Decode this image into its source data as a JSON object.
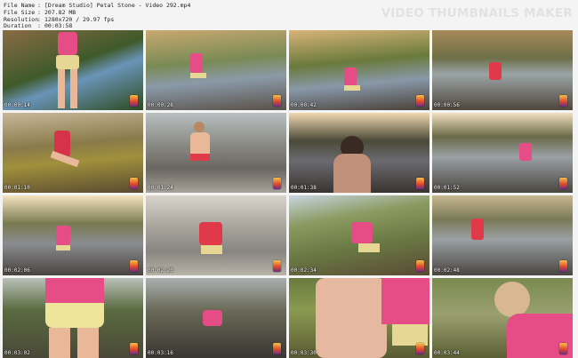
{
  "header": {
    "rows": [
      {
        "key": "File Name",
        "sep": ":",
        "value": "[Dream Studio] Petal Stone - Video 292.mp4"
      },
      {
        "key": "File Size",
        "sep": ":",
        "value": "207.82 MB"
      },
      {
        "key": "Resolution",
        "sep": ":",
        "value": "1280x720 / 29.97 fps"
      },
      {
        "key": "Duration",
        "sep": ":",
        "value": "00:03:58"
      }
    ],
    "watermark": "VIDEO THUMBNAILS MAKER"
  },
  "thumbnails": [
    {
      "time": "00:00:14"
    },
    {
      "time": "00:00:28"
    },
    {
      "time": "00:00:42"
    },
    {
      "time": "00:00:56"
    },
    {
      "time": "00:01:10"
    },
    {
      "time": "00:01:24"
    },
    {
      "time": "00:01:38"
    },
    {
      "time": "00:01:52"
    },
    {
      "time": "00:02:06"
    },
    {
      "time": "00:02:20"
    },
    {
      "time": "00:02:34"
    },
    {
      "time": "00:02:48"
    },
    {
      "time": "00:03:02"
    },
    {
      "time": "00:03:16"
    },
    {
      "time": "00:03:30"
    },
    {
      "time": "00:03:44"
    }
  ]
}
